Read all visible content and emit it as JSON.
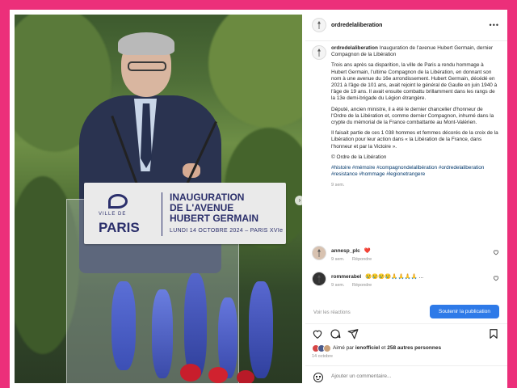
{
  "post": {
    "username": "ordredelaliberation",
    "more_icon": "more-horizontal-icon",
    "next_icon": "chevron-right-icon"
  },
  "photo": {
    "sign": {
      "logo_small": "VILLE DE",
      "logo_city": "PARIS",
      "title_line1": "INAUGURATION",
      "title_line2": "DE L'AVENUE",
      "title_line3": "HUBERT GERMAIN",
      "date": "LUNDI 14 OCTOBRE 2024 – PARIS XVIe"
    }
  },
  "caption": {
    "username": "ordredelaliberation",
    "intro": "Inauguration de l'avenue Hubert Germain, dernier Compagnon de la Libération",
    "p1": "Trois ans après sa disparition, la ville de Paris a rendu hommage à Hubert Germain, l'ultime Compagnon de la Libération, en donnant son nom à une avenue du 16e arrondissement. Hubert Germain, décédé en 2021 à l'âge de 101 ans, avait rejoint le général de Gaulle en juin 1940 à l'âge de 19 ans. Il avait ensuite combattu brillamment dans les rangs de la 13e demi-brigade du Légion étrangère.",
    "p2": "Député, ancien ministre, il a été le dernier chancelier d'honneur de l'Ordre de la Libération et, comme dernier Compagnon, inhumé dans la crypte du mémorial de la France combattante au Mont-Valérien.",
    "p3": "Il faisait partie de ces 1 038 hommes et femmes décorés de la croix de la Libération pour leur action dans « la Libération de la France, dans l'honneur et par la Victoire ».",
    "p4": "© Ordre de la Libération",
    "tags": "#histoire #mémoire #compagnondelalibération #ordredelaliberation #resistance #hommage #legionetrangere",
    "age": "9 sem."
  },
  "comments": [
    {
      "username": "annesp_plc",
      "text": "❤️",
      "age": "9 sem.",
      "reply": "Répondre"
    },
    {
      "username": "rommerabel",
      "text": "😢😢😢😢🙏🙏🙏🙏 ...",
      "age": "9 sem.",
      "reply": "Répondre"
    }
  ],
  "bar": {
    "view_replies": "Voir les réactions",
    "follow_button": "Soutenir la publication"
  },
  "actions": {
    "like_icon": "heart-icon",
    "comment_icon": "comment-icon",
    "share_icon": "send-icon",
    "save_icon": "bookmark-icon"
  },
  "likes": {
    "prefix": "Aimé par ",
    "user": "ienofficiel",
    "middle": " et ",
    "count": "258 autres personnes",
    "date": "14 octobre"
  },
  "add_comment": {
    "placeholder": "Ajouter un commentaire..."
  },
  "colors": {
    "background": "#ec2f7a",
    "accent": "#2e7ae8",
    "sign_text": "#2b2f6b",
    "hashtag": "#00376b"
  }
}
